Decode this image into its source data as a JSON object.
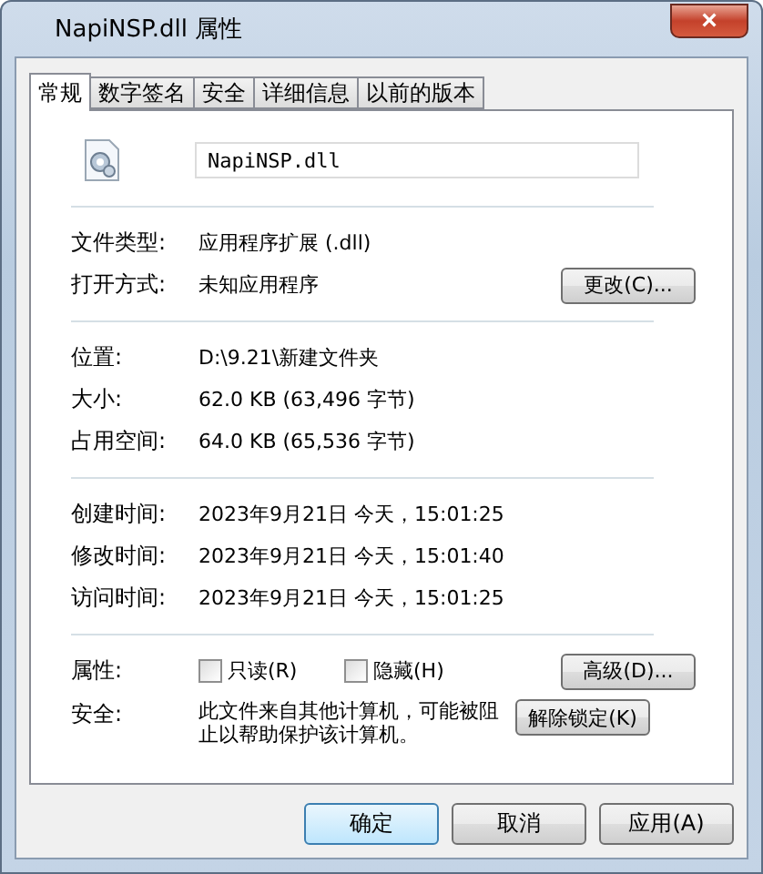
{
  "window": {
    "title": "NapiNSP.dll 属性",
    "close": "×"
  },
  "tabs": [
    {
      "label": "常规",
      "selected": true
    },
    {
      "label": "数字签名",
      "selected": false
    },
    {
      "label": "安全",
      "selected": false
    },
    {
      "label": "详细信息",
      "selected": false
    },
    {
      "label": "以前的版本",
      "selected": false
    }
  ],
  "file_name": "NapiNSP.dll",
  "groups": [
    [
      {
        "label": "文件类型:",
        "value": "应用程序扩展 (.dll)"
      },
      {
        "label": "打开方式:",
        "value": "未知应用程序",
        "button": "更改(C)..."
      }
    ],
    [
      {
        "label": "位置:",
        "value": "D:\\9.21\\新建文件夹"
      },
      {
        "label": "大小:",
        "value": "62.0 KB (63,496 字节)"
      },
      {
        "label": "占用空间:",
        "value": "64.0 KB (65,536 字节)"
      }
    ],
    [
      {
        "label": "创建时间:",
        "value": "2023年9月21日 今天，15:01:25"
      },
      {
        "label": "修改时间:",
        "value": "2023年9月21日 今天，15:01:40"
      },
      {
        "label": "访问时间:",
        "value": "2023年9月21日 今天，15:01:25"
      }
    ]
  ],
  "attributes": {
    "label": "属性:",
    "checkboxes": [
      {
        "label": "只读(R)",
        "checked": false
      },
      {
        "label": "隐藏(H)",
        "checked": false
      }
    ],
    "button": "高级(D)..."
  },
  "security": {
    "label": "安全:",
    "text": "此文件来自其他计算机，可能被阻止以帮助保护该计算机。",
    "button": "解除锁定(K)"
  },
  "buttons": [
    {
      "label": "确定",
      "default": true
    },
    {
      "label": "取消",
      "default": false
    },
    {
      "label": "应用(A)",
      "default": false
    }
  ]
}
